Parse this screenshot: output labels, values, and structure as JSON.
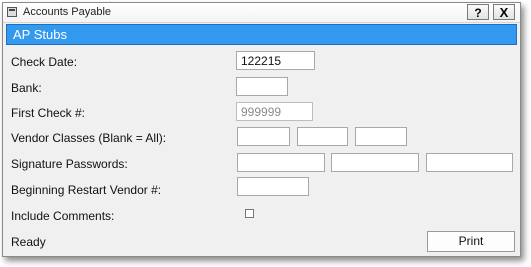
{
  "window": {
    "title": "Accounts Payable",
    "help_label": "?",
    "close_label": "X"
  },
  "header": {
    "title": "AP Stubs"
  },
  "form": {
    "check_date": {
      "label": "Check Date:",
      "value": "122215"
    },
    "bank": {
      "label": "Bank:",
      "value": ""
    },
    "first_check": {
      "label": "First Check #:",
      "value": "999999"
    },
    "vendor_classes": {
      "label": "Vendor Classes (Blank = All):",
      "values": [
        "",
        "",
        ""
      ]
    },
    "signature_passwords": {
      "label": "Signature Passwords:",
      "values": [
        "",
        "",
        ""
      ]
    },
    "restart_vendor": {
      "label": "Beginning Restart Vendor #:",
      "value": ""
    },
    "include_comments": {
      "label": "Include Comments:",
      "checked": false
    }
  },
  "status": {
    "text": "Ready"
  },
  "actions": {
    "print_label": "Print"
  },
  "colors": {
    "header_bar": "#3399ee",
    "header_text": "#ffffff",
    "window_bg": "#f0f0f0"
  }
}
